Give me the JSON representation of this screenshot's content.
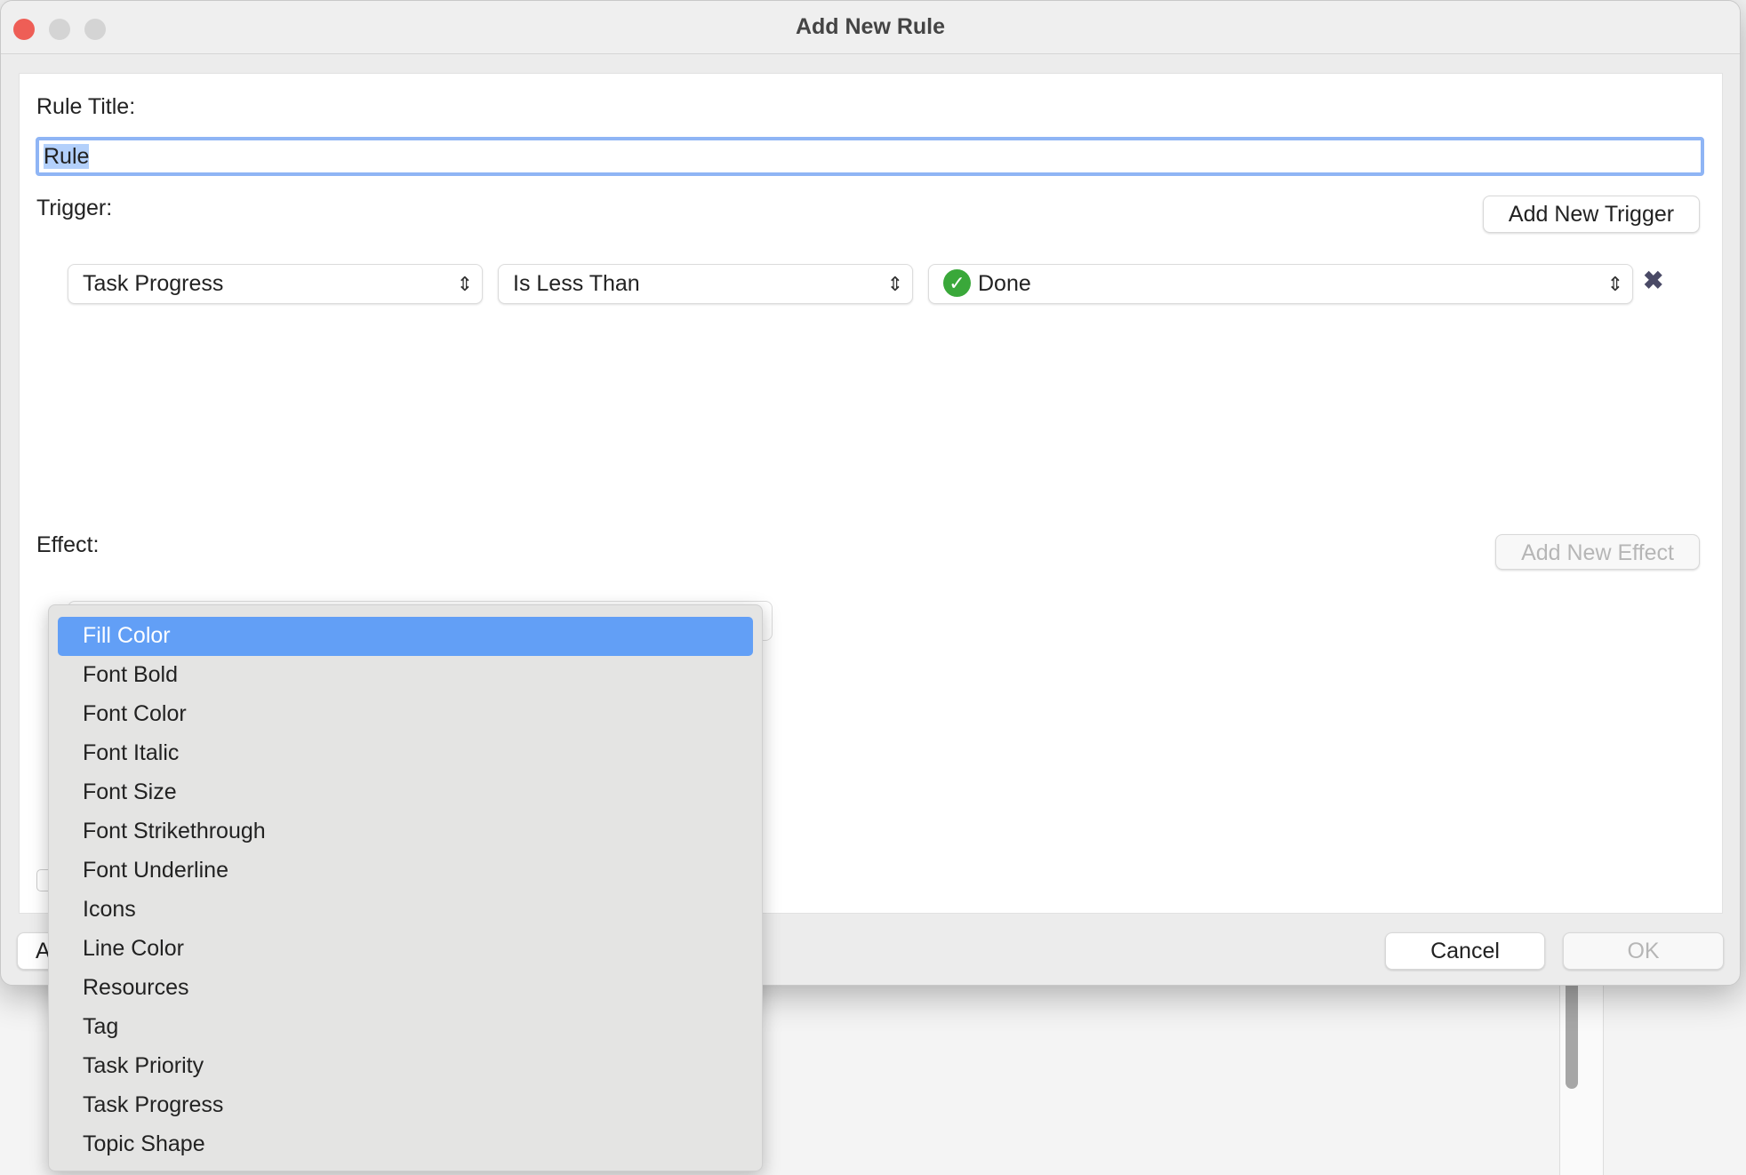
{
  "window": {
    "title": "Add New Rule"
  },
  "rule_title": {
    "label": "Rule Title:",
    "value": "Rule"
  },
  "trigger": {
    "label": "Trigger:",
    "add_button": "Add New Trigger",
    "row": {
      "field": "Task Progress",
      "operator": "Is Less Than",
      "value": "Done",
      "value_icon": "green-check-circle-icon",
      "remove_icon": "close-x-icon"
    }
  },
  "effect": {
    "label": "Effect:",
    "add_button": "Add New Effect",
    "menu_items": [
      "Fill Color",
      "Font Bold",
      "Font Color",
      "Font Italic",
      "Font Size",
      "Font Strikethrough",
      "Font Underline",
      "Icons",
      "Line Color",
      "Resources",
      "Tag",
      "Task Priority",
      "Task Progress",
      "Topic Shape"
    ],
    "selected": "Fill Color"
  },
  "footer": {
    "left_button_partial": "A",
    "cancel": "Cancel",
    "ok": "OK"
  },
  "colors": {
    "accent": "#629ff6",
    "focus_ring": "#8fb5f5",
    "check": "#3aa83a"
  }
}
